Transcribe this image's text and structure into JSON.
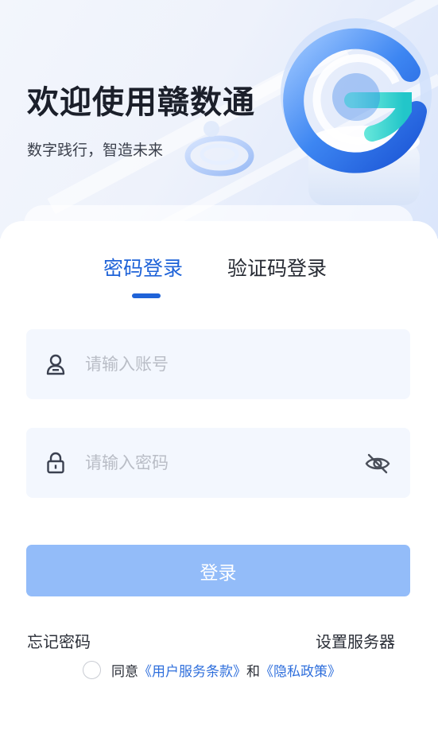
{
  "hero": {
    "title": "欢迎使用赣数通",
    "subtitle": "数字践行，智造未来"
  },
  "tabs": [
    {
      "label": "密码登录",
      "active": true
    },
    {
      "label": "验证码登录",
      "active": false
    }
  ],
  "form": {
    "account_placeholder": "请输入账号",
    "account_value": "",
    "password_placeholder": "请输入密码",
    "password_value": "",
    "login_label": "登录"
  },
  "links": {
    "forgot_password": "忘记密码",
    "set_server": "设置服务器"
  },
  "agreement": {
    "checked": false,
    "prefix": "同意",
    "terms": "《用户服务条款》",
    "and": "和",
    "privacy": "《隐私政策》"
  },
  "icons": {
    "account": "user-icon",
    "password": "lock-icon",
    "visibility": "eye-off-icon"
  },
  "colors": {
    "accent": "#1f63d8",
    "login_button": "#93bcf9",
    "field_background": "#f3f7fe",
    "link_blue": "#2f6fdc"
  }
}
